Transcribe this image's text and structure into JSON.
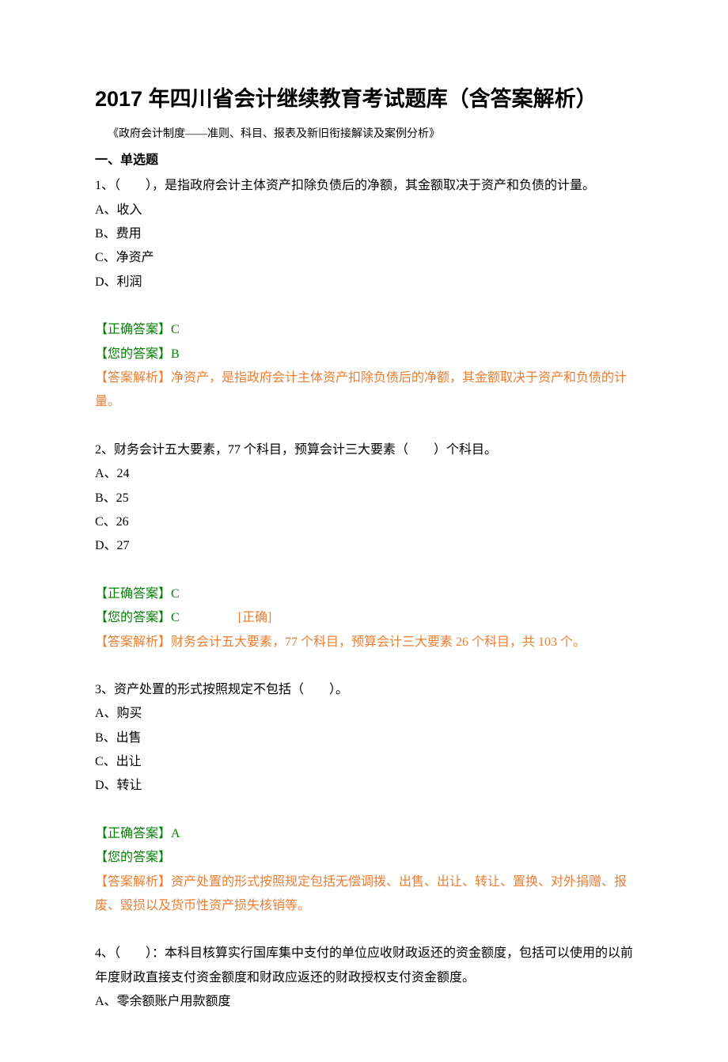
{
  "title": "2017 年四川省会计继续教育考试题库（含答案解析）",
  "subtitle": "《政府会计制度——准则、科目、报表及新旧衔接解读及案例分析》",
  "section_heading": "一、单选题",
  "q1": {
    "text": "1、（　　），是指政府会计主体资产扣除负债后的净额，其金额取决于资产和负债的计量。",
    "a": "A、收入",
    "b": "B、费用",
    "c": "C、净资产",
    "d": "D、利润",
    "correct_label": "【正确答案】C",
    "your_label": "【您的答案】B",
    "explain": "【答案解析】净资产，是指政府会计主体资产扣除负债后的净额，其金额取决于资产和负债的计量。"
  },
  "q2": {
    "text": "2、财务会计五大要素，77 个科目，预算会计三大要素（　　）个科目。",
    "a": "A、24",
    "b": "B、25",
    "c": "C、26",
    "d": "D、27",
    "correct_label": "【正确答案】C",
    "your_label": "【您的答案】C",
    "correct_tag": "[正确]",
    "explain": "【答案解析】财务会计五大要素，77 个科目，预算会计三大要素 26 个科目，共 103 个。"
  },
  "q3": {
    "text": "3、资产处置的形式按照规定不包括（　　）。",
    "a": "A、购买",
    "b": "B、出售",
    "c": "C、出让",
    "d": "D、转让",
    "correct_label": "【正确答案】A",
    "your_label": "【您的答案】",
    "explain": "【答案解析】资产处置的形式按照规定包括无偿调拨、出售、出让、转让、置换、对外捐赠、报废、毁损以及货币性资产损失核销等。"
  },
  "q4": {
    "text": "4、（　　）：本科目核算实行国库集中支付的单位应收财政返还的资金额度，包括可以使用的以前年度财政直接支付资金额度和财政应返还的财政授权支付资金额度。",
    "a": "A、零余额账户用款额度"
  }
}
